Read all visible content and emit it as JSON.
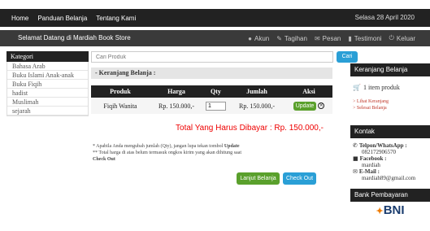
{
  "topnav": {
    "links": [
      "Home",
      "Panduan Belanja",
      "Tentang Kami"
    ],
    "date": "Selasa 28 April 2020"
  },
  "welcomebar": {
    "text": "Selamat Datang di Mardiah Book Store",
    "links": [
      "Akun",
      "Tagihan",
      "Pesan",
      "Testimoni",
      "Keluar"
    ]
  },
  "sidebar": {
    "title": "Kategori",
    "items": [
      "Bahasa Arab",
      "Buku Islami Anak-anak",
      "Buku Fiqih",
      "hadist",
      "Muslimah",
      "sejarah"
    ]
  },
  "search": {
    "placeholder": "Cari Produk",
    "button": "Cari"
  },
  "cart": {
    "title": "- Keranjang Belanja :",
    "headers": [
      "Produk",
      "Harga",
      "Qty",
      "Jumlah",
      "Aksi"
    ],
    "row": {
      "product": "Fiqih Wanita",
      "price": "Rp. 150.000,-",
      "qty": "1",
      "amount": "Rp. 150.000,-",
      "update": "Update"
    },
    "total": "Total Yang Harus Dibayar : Rp. 150.000,-",
    "note1": "* Apabila Anda mengubah jumlah (Qty), jangan lupa tekan tombol ",
    "note1_bold": "Update",
    "note2": "** Total harga di atas belum termasuk ongkos kirim yang akan dihitung saat",
    "note3": "Check Out",
    "continue": "Lanjut Belanja",
    "checkout": "Check Out"
  },
  "right": {
    "cart_title": "Keranjang Belanja",
    "cart_items": "1 item produk",
    "view_cart": "> Lihat Keranjang",
    "finish": "> Selesai Belanja",
    "contact_title": "Kontak",
    "phone_label": "Telpon/WhatsApp :",
    "phone": "082172906570",
    "fb_label": "Facebook :",
    "fb": "mardiah",
    "email_label": "E-Mail :",
    "email": "mardiah89@gmail.com",
    "bank_title": "Bank Pembayaran",
    "bank": "BNI"
  }
}
